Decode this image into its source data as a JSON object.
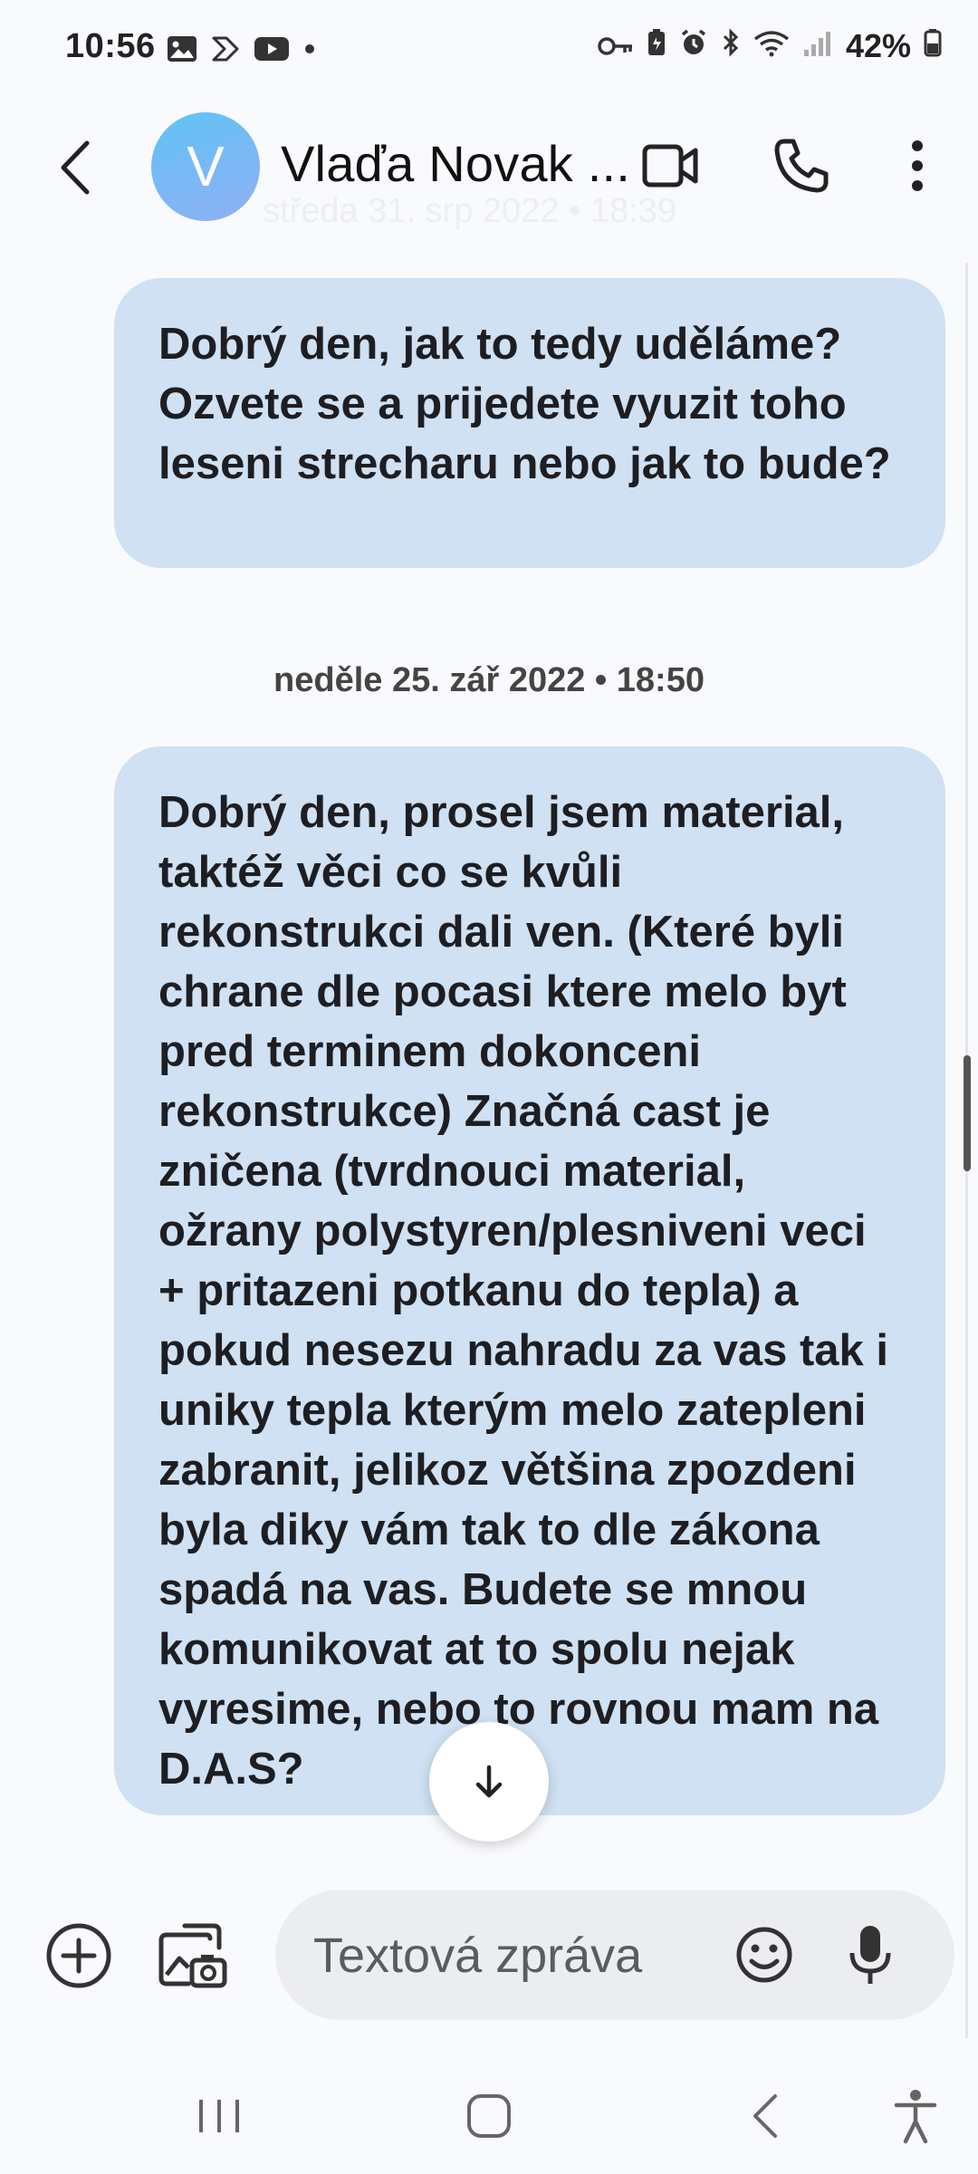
{
  "status_bar": {
    "time": "10:56",
    "battery": "42%",
    "left_icons": [
      "gallery-icon",
      "smart-switch-icon",
      "youtube-icon",
      "dot-icon"
    ],
    "right_icons": [
      "key-icon",
      "battery-saver-icon",
      "alarm-icon",
      "bluetooth-icon",
      "wifi-icon",
      "signal-icon",
      "battery-icon"
    ]
  },
  "header": {
    "avatar_letter": "V",
    "contact_name": "Vlaďa Novak ...",
    "ghost_date": "středa 31. srp 2022 • 18:39"
  },
  "messages": [
    {
      "text": "Dobrý den,  jak to tedy uděláme? Ozvete se a prijedete vyuzit toho leseni strecharu nebo jak to bude?"
    },
    {
      "date_separator": "neděle 25. zář 2022 • 18:50"
    },
    {
      "text": "Dobrý den, prosel jsem material, taktéž věci co se kvůli rekonstrukci dali ven. (Které byli chrane dle pocasi ktere melo byt pred terminem dokonceni rekonstrukce) Značná cast je zničena (tvrdnouci material, ožrany polystyren/plesniveni veci + pritazeni potkanu do tepla) a pokud nesezu nahradu za vas tak i uniky tepla kterým melo zatepleni zabranit, jelikoz většina zpozdeni byla diky vám tak to dle zákona spadá na vas. Budete se mnou komunikovat at to spolu nejak vyresime, nebo to rovnou mam na D.A.S?"
    }
  ],
  "compose": {
    "placeholder": "Textová zpráva"
  },
  "colors": {
    "background": "#f9fafd",
    "bubble": "#cfe1f2",
    "compose_field": "#ebedf1",
    "avatar": "#6fbef5"
  }
}
